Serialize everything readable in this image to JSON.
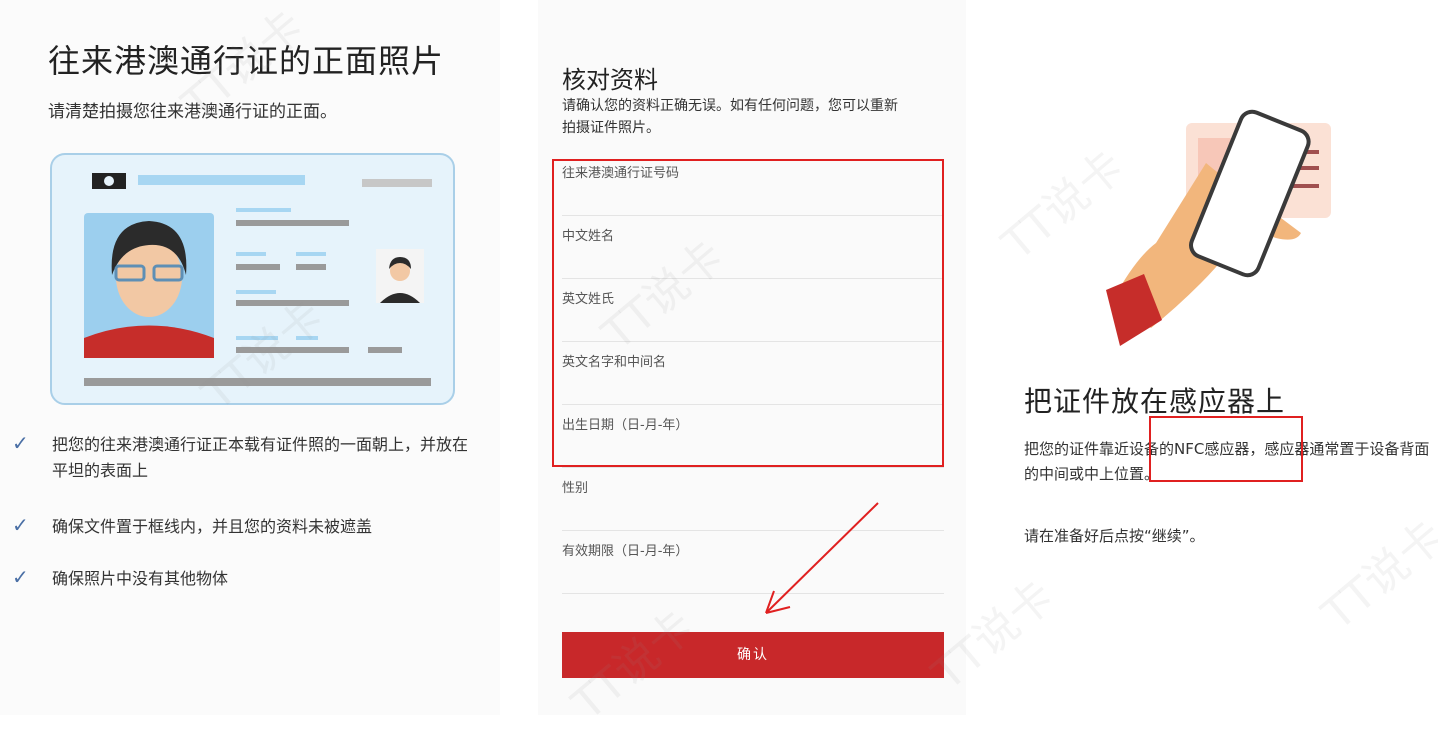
{
  "panel1": {
    "title": "往来港澳通行证的正面照片",
    "subtitle": "请清楚拍摄您往来港澳通行证的正面。",
    "checklist": [
      "把您的往来港澳通行证正本载有证件照的一面朝上，并放在平坦的表面上",
      "确保文件置于框线内，并且您的资料未被遮盖",
      "确保照片中没有其他物体"
    ]
  },
  "panel2": {
    "title": "核对资料",
    "description": "请确认您的资料正确无误。如有任何问题，您可以重新拍摄证件照片。",
    "fields": [
      "往来港澳通行证号码",
      "中文姓名",
      "英文姓氏",
      "英文名字和中间名",
      "出生日期（日-月-年）",
      "性别",
      "有效期限（日-月-年）"
    ],
    "confirm_label": "确认"
  },
  "panel3": {
    "title": "把证件放在感应器上",
    "description": "把您的证件靠近设备的NFC感应器，感应器通常置于设备背面的中间或中上位置。",
    "prompt": "请在准备好后点按“继续”。"
  },
  "watermark": "TT说卡",
  "colors": {
    "accent_red": "#c8282a",
    "annotation_red": "#e02020",
    "check_blue": "#4a6fa5"
  },
  "icons": [
    "check-icon",
    "id-card-illustration",
    "hand-phone-illustration",
    "annotation-arrow"
  ]
}
